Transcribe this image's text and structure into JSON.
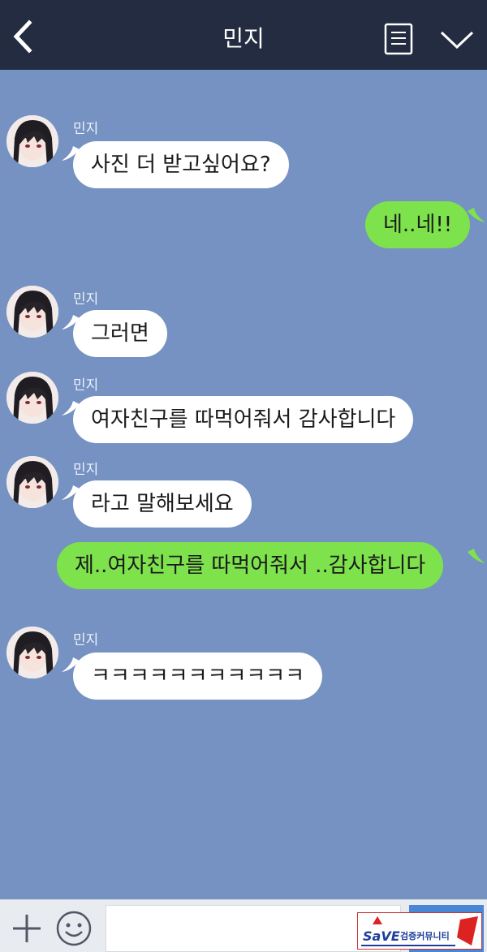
{
  "header": {
    "title": "민지",
    "back_icon": "chevron-left-icon",
    "menu_icon": "document-list-icon",
    "collapse_icon": "chevron-down-icon"
  },
  "messages": [
    {
      "direction": "in",
      "sender": "민지",
      "text": "사진 더 받고싶어요?"
    },
    {
      "direction": "out",
      "text": "네..네!!"
    },
    {
      "direction": "in",
      "sender": "민지",
      "text": "그러면"
    },
    {
      "direction": "in",
      "sender": "민지",
      "text": "여자친구를 따먹어줘서 감사합니다"
    },
    {
      "direction": "in",
      "sender": "민지",
      "text": "라고 말해보세요"
    },
    {
      "direction": "out",
      "text": "제..여자친구를 따먹어줘서 ..감사합니다"
    },
    {
      "direction": "in",
      "sender": "민지",
      "text": "ㅋㅋㅋㅋㅋㅋㅋㅋㅋㅋㅋ"
    }
  ],
  "input_bar": {
    "plus_icon": "plus-icon",
    "emoji_icon": "smiley-icon",
    "message_value": "",
    "send_icon": "send-icon"
  },
  "colors": {
    "header_bg": "#232c40",
    "chat_bg": "#7592c2",
    "incoming_bubble": "#ffffff",
    "outgoing_bubble": "#7ee24d",
    "send_button": "#4a86d6"
  }
}
